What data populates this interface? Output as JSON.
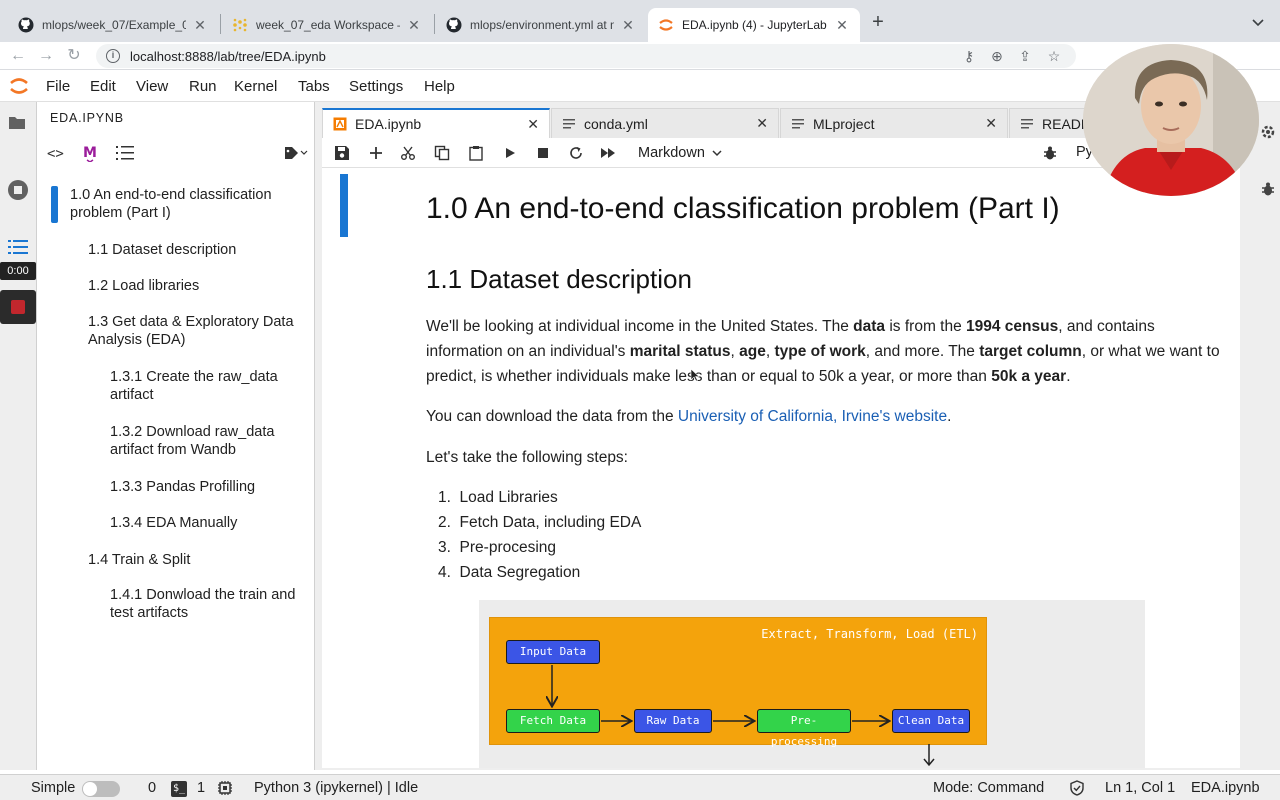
{
  "browser": {
    "tabs": [
      {
        "title": "mlops/week_07/Example_01 at",
        "icon": "github-icon"
      },
      {
        "title": "week_07_eda Workspace – We",
        "icon": "wandb-icon"
      },
      {
        "title": "mlops/environment.yml at mai",
        "icon": "github-icon"
      },
      {
        "title": "EDA.ipynb (4) - JupyterLab",
        "icon": "jupyter-icon"
      }
    ],
    "new_tab": "+",
    "url": "localhost:8888/lab/tree/EDA.ipynb"
  },
  "menubar": {
    "items": [
      "File",
      "Edit",
      "View",
      "Run",
      "Kernel",
      "Tabs",
      "Settings",
      "Help"
    ]
  },
  "leftbar": {
    "timer": "0:00"
  },
  "toc": {
    "title": "EDA.IPYNB",
    "items": [
      {
        "text": "1.0 An end-to-end classification problem (Part I)",
        "level": 1,
        "active": true
      },
      {
        "text": "1.1 Dataset description",
        "level": 2
      },
      {
        "text": "1.2 Load libraries",
        "level": 2
      },
      {
        "text": "1.3 Get data & Exploratory Data Analysis (EDA)",
        "level": 2
      },
      {
        "text": "1.3.1 Create the raw_data artifact",
        "level": 3
      },
      {
        "text": "1.3.2 Download raw_data artifact from Wandb",
        "level": 3
      },
      {
        "text": "1.3.3 Pandas Profilling",
        "level": 3
      },
      {
        "text": "1.3.4 EDA Manually",
        "level": 3
      },
      {
        "text": "1.4 Train & Split",
        "level": 2
      },
      {
        "text": "1.4.1 Donwload the train and test artifacts",
        "level": 3
      }
    ]
  },
  "doctabs": [
    {
      "title": "EDA.ipynb",
      "active": true
    },
    {
      "title": "conda.yml"
    },
    {
      "title": "MLproject"
    },
    {
      "title": "READM"
    }
  ],
  "toolbar": {
    "cell_type": "Markdown",
    "kernel_short": "Py"
  },
  "notebook": {
    "h1": "1.0 An end-to-end classification problem (Part I)",
    "h2": "1.1 Dataset description",
    "p1": [
      {
        "t": "We'll be looking at individual income in the United States. The ",
        "b": false
      },
      {
        "t": "data",
        "b": true
      },
      {
        "t": " is from the ",
        "b": false
      },
      {
        "t": "1994 census",
        "b": true
      },
      {
        "t": ", and contains information on an individual's ",
        "b": false
      },
      {
        "t": "marital status",
        "b": true
      },
      {
        "t": ", ",
        "b": false
      },
      {
        "t": "age",
        "b": true
      },
      {
        "t": ", ",
        "b": false
      },
      {
        "t": "type of work",
        "b": true
      },
      {
        "t": ", and more. The ",
        "b": false
      },
      {
        "t": "target column",
        "b": true
      },
      {
        "t": ", or what we want to predict, is whether individuals make less than or equal to 50k a year, or more than ",
        "b": false
      },
      {
        "t": "50k a year",
        "b": true
      },
      {
        "t": ".",
        "b": false
      }
    ],
    "p2_prefix": "You can download the data from the ",
    "p2_link": "University of California, Irvine's website",
    "p2_suffix": ".",
    "p3": "Let's take the following steps:",
    "steps": [
      "Load Libraries",
      "Fetch Data, including EDA",
      "Pre-procesing",
      "Data Segregation"
    ],
    "figure": {
      "title": "Extract, Transform, Load (ETL)",
      "nodes": [
        "Input Data",
        "Fetch Data",
        "Raw Data",
        "Pre-processing",
        "Clean Data"
      ]
    }
  },
  "statusbar": {
    "mode_label": "Simple",
    "count_a": "0",
    "count_b": "1",
    "kernel": "Python 3 (ipykernel) | Idle",
    "mode": "Mode: Command",
    "position": "Ln 1, Col 1",
    "file": "EDA.ipynb"
  },
  "colors": {
    "accent": "#1976d2",
    "etl_bg": "#f4a30c",
    "node_blue": "#3b55e6",
    "node_green": "#33d34a",
    "link": "#1a5fb4"
  }
}
